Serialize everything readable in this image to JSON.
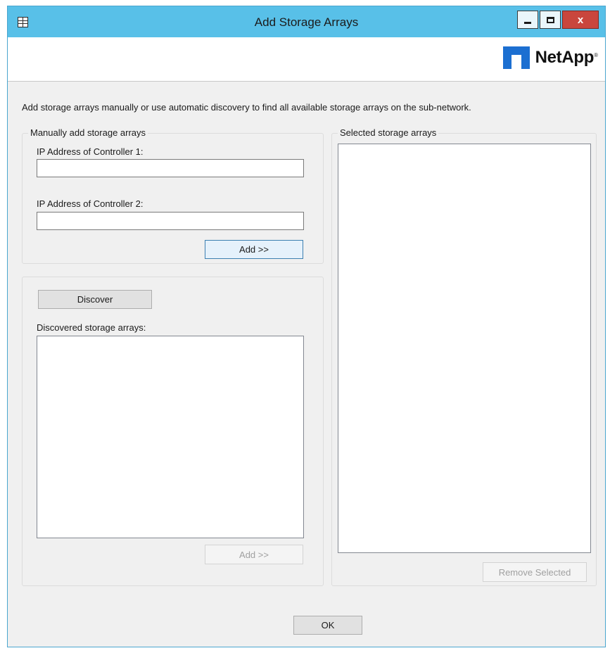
{
  "window": {
    "title": "Add Storage Arrays",
    "close_label": "x",
    "icons": {
      "system": "window-menu-icon",
      "minimize": "minimize-icon",
      "maximize": "maximize-icon",
      "close": "close-icon"
    },
    "colors": {
      "titlebar": "#58c0e8",
      "close": "#c9463d",
      "logo": "#1c6fd1"
    }
  },
  "banner": {
    "logo_text": "NetApp",
    "logo_icon": "netapp-logo-icon",
    "trademark": "®"
  },
  "intro_text": "Add storage arrays manually or use automatic discovery to find all available storage arrays on the sub-network.",
  "manual": {
    "legend": "Manually add storage arrays",
    "controller1_label": "IP Address of Controller 1:",
    "controller1_value": "",
    "controller2_label": "IP Address of Controller 2:",
    "controller2_value": "",
    "add_label": "Add >>"
  },
  "discovery": {
    "discover_label": "Discover",
    "list_label": "Discovered storage arrays:",
    "items": [],
    "add_label": "Add >>"
  },
  "selected": {
    "legend": "Selected storage arrays",
    "items": [],
    "remove_label": "Remove Selected"
  },
  "footer": {
    "ok_label": "OK"
  }
}
